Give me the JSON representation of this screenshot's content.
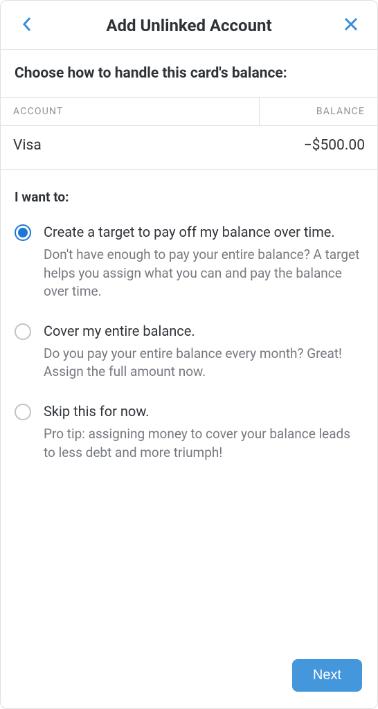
{
  "header": {
    "title": "Add Unlinked Account"
  },
  "intro": "Choose how to handle this card's balance:",
  "table": {
    "col_account": "ACCOUNT",
    "col_balance": "BALANCE",
    "row": {
      "account": "Visa",
      "balance": "−$500.00"
    }
  },
  "section_label": "I want to:",
  "options": [
    {
      "title": "Create a target to pay off my balance over time.",
      "desc": "Don't have enough to pay your entire balance? A target helps you assign what you can and pay the balance over time.",
      "selected": true
    },
    {
      "title": "Cover my entire balance.",
      "desc": "Do you pay your entire balance every month? Great! Assign the full amount now.",
      "selected": false
    },
    {
      "title": "Skip this for now.",
      "desc": "Pro tip: assigning money to cover your balance leads to less debt and more triumph!",
      "selected": false
    }
  ],
  "footer": {
    "next": "Next"
  }
}
